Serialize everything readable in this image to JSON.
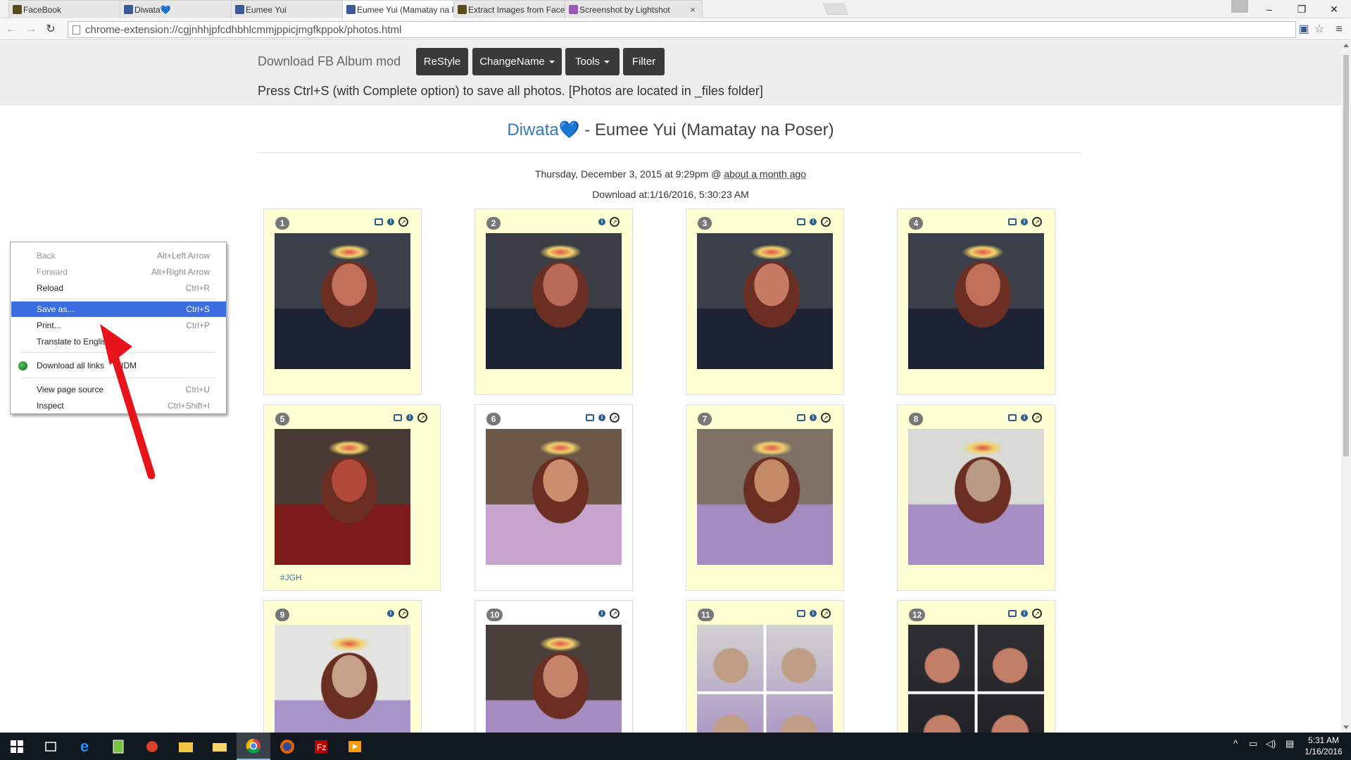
{
  "browser": {
    "tabs": [
      {
        "label": "FaceBook",
        "favicon_color": "#5a4a1c"
      },
      {
        "label": "Diwata💙",
        "favicon_color": "#3b5998"
      },
      {
        "label": "Eumee Yui",
        "favicon_color": "#3b5998"
      },
      {
        "label": "Eumee Yui (Mamatay na P",
        "favicon_color": "#3b5998"
      },
      {
        "label": "Extract Images from Faceb",
        "favicon_color": "#5a4a1c"
      },
      {
        "label": "Screenshot by Lightshot",
        "favicon_color": "#9b59b6"
      }
    ],
    "active_tab": 3,
    "url": "chrome-extension://cgjnhhjpfcdhbhlcmmjppicjmgfkppok/photos.html"
  },
  "header": {
    "brand": "Download FB Album mod",
    "buttons": [
      "ReStyle",
      "ChangeName",
      "Tools",
      "Filter"
    ],
    "notice": "Press Ctrl+S (with Complete option) to save all photos. [Photos are located in _files folder]"
  },
  "album": {
    "owner": "Diwata",
    "heart": "💙",
    "title_rest": " - Eumee Yui (Mamatay na Poser)",
    "date_prefix": "Thursday, December 3, 2015 at 9:29pm @ ",
    "date_ago": "about a month ago",
    "download_at": "Download at:1/16/2016, 5:30:23 AM"
  },
  "photos": [
    {
      "num": "1",
      "tag": ""
    },
    {
      "num": "2",
      "tag": ""
    },
    {
      "num": "3",
      "tag": ""
    },
    {
      "num": "4",
      "tag": ""
    },
    {
      "num": "5",
      "tag": "#JGH"
    },
    {
      "num": "6",
      "tag": ""
    },
    {
      "num": "7",
      "tag": ""
    },
    {
      "num": "8",
      "tag": ""
    },
    {
      "num": "9",
      "tag": ""
    },
    {
      "num": "10",
      "tag": ""
    },
    {
      "num": "11",
      "tag": ""
    },
    {
      "num": "12",
      "tag": ""
    }
  ],
  "context_menu": {
    "items": [
      {
        "label": "Back",
        "shortcut": "Alt+Left Arrow"
      },
      {
        "label": "Forward",
        "shortcut": "Alt+Right Arrow"
      },
      {
        "label": "Reload",
        "shortcut": "Ctrl+R"
      },
      {
        "label": "Save as...",
        "shortcut": "Ctrl+S"
      },
      {
        "label": "Print...",
        "shortcut": "Ctrl+P"
      },
      {
        "label": "Translate to Englis",
        "shortcut": ""
      },
      {
        "label": "Download all links",
        "label_tail": "IDM",
        "shortcut": ""
      },
      {
        "label": "View page source",
        "shortcut": "Ctrl+U"
      },
      {
        "label": "Inspect",
        "shortcut": "Ctrl+Shift+I"
      }
    ]
  },
  "taskbar": {
    "time": "5:31 AM",
    "date": "1/16/2016"
  },
  "colors": {
    "card_bg": "#ffffd4",
    "button_bg": "#3a3a3a",
    "menu_highlight": "#3c6ee2",
    "link": "#337ab7",
    "arrow": "#e8141b"
  }
}
